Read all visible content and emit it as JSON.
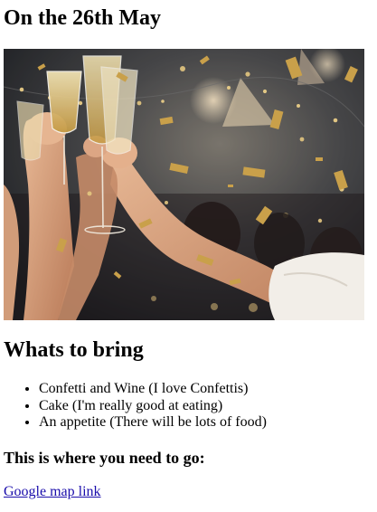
{
  "page": {
    "title": "On the 26th May",
    "photo": {
      "icon": "celebration-toast-photo",
      "description_colors": {
        "background": "#3a3f45",
        "confetti": "#c9a04a",
        "skin": "#d9a07c"
      }
    },
    "bring_heading": "Whats to bring",
    "bring_items": [
      "Confetti and Wine (I love Confettis)",
      "Cake (I'm really good at eating)",
      "An appetite (There will be lots of food)"
    ],
    "location_heading": "This is where you need to go:",
    "map_link_text": "Google map link",
    "link_color": "#1a0dab"
  }
}
